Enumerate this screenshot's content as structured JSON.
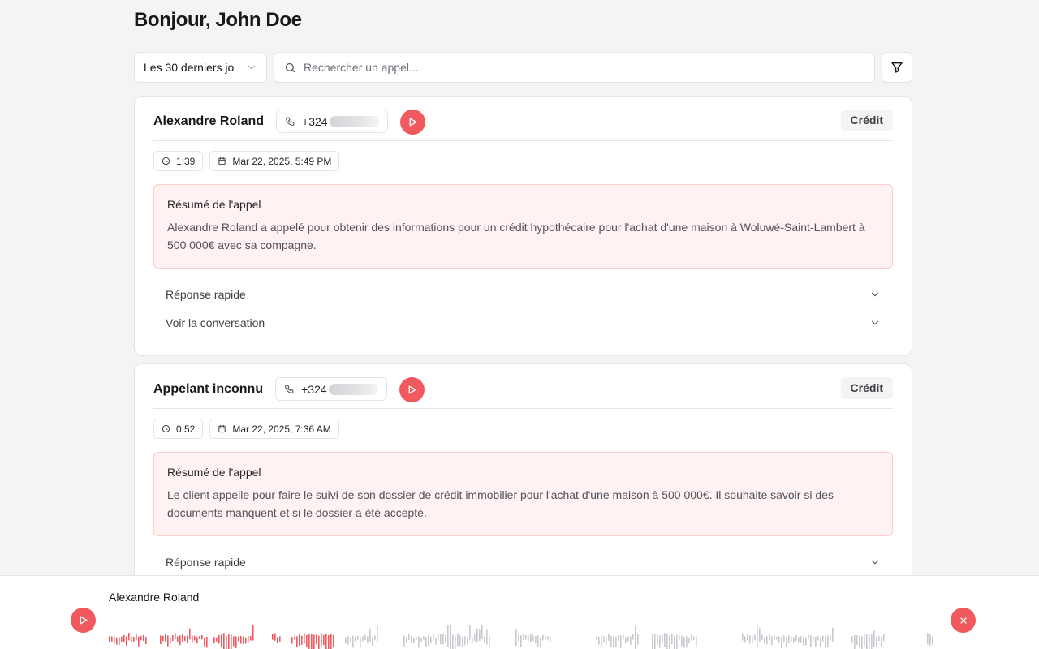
{
  "header": {
    "greeting": "Bonjour, John Doe"
  },
  "toolbar": {
    "period_value": "Les 30 derniers jo",
    "search_placeholder": "Rechercher un appel..."
  },
  "calls": [
    {
      "caller": "Alexandre Roland",
      "phone_prefix": "+324",
      "tag": "Crédit",
      "duration": "1:39",
      "datetime": "Mar 22, 2025, 5:49 PM",
      "summary_title": "Résumé de l'appel",
      "summary": "Alexandre Roland a appelé pour obtenir des informations pour un crédit hypothécaire pour l'achat d'une maison à Woluwé-Saint-Lambert à 500 000€ avec sa compagne.",
      "quick_reply": "Réponse rapide",
      "view_conversation": "Voir la conversation"
    },
    {
      "caller": "Appelant inconnu",
      "phone_prefix": "+324",
      "tag": "Crédit",
      "duration": "0:52",
      "datetime": "Mar 22, 2025, 7:36 AM",
      "summary_title": "Résumé de l'appel",
      "summary": "Le client appelle pour faire le suivi de son dossier de crédit immobilier pour l'achat d'une maison à 500 000€. Il souhaite savoir si des documents manquent et si le dossier a été accepté.",
      "quick_reply": "Réponse rapide"
    }
  ],
  "player": {
    "title": "Alexandre Roland",
    "progress": 0.275,
    "played_color": "#f05a5f",
    "unplayed_color": "#c9c9cf"
  },
  "icons": {
    "period": "chevron-down-icon",
    "search": "search-icon",
    "filter": "filter-icon",
    "phone": "phone-icon",
    "play": "play-icon",
    "duration": "clock-icon",
    "date": "calendar-icon",
    "expand": "chevron-down-icon",
    "close": "close-icon"
  }
}
